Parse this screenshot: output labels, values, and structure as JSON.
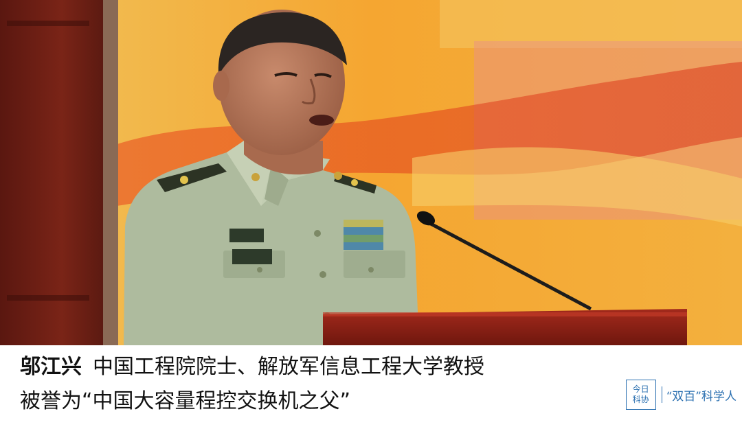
{
  "caption": {
    "name": "邬江兴",
    "line1": "中国工程院院士、解放军信息工程大学教授",
    "line2": "被誉为“中国大容量程控交换机之父”"
  },
  "badge": {
    "box_line1": "今日",
    "box_line2": "科协",
    "text": "“双百”科学人"
  },
  "colors": {
    "background_orange": "#f3a234",
    "uniform_green": "#a9b79a",
    "podium_red": "#8a1f14",
    "badge_blue": "#2a6fb0"
  }
}
